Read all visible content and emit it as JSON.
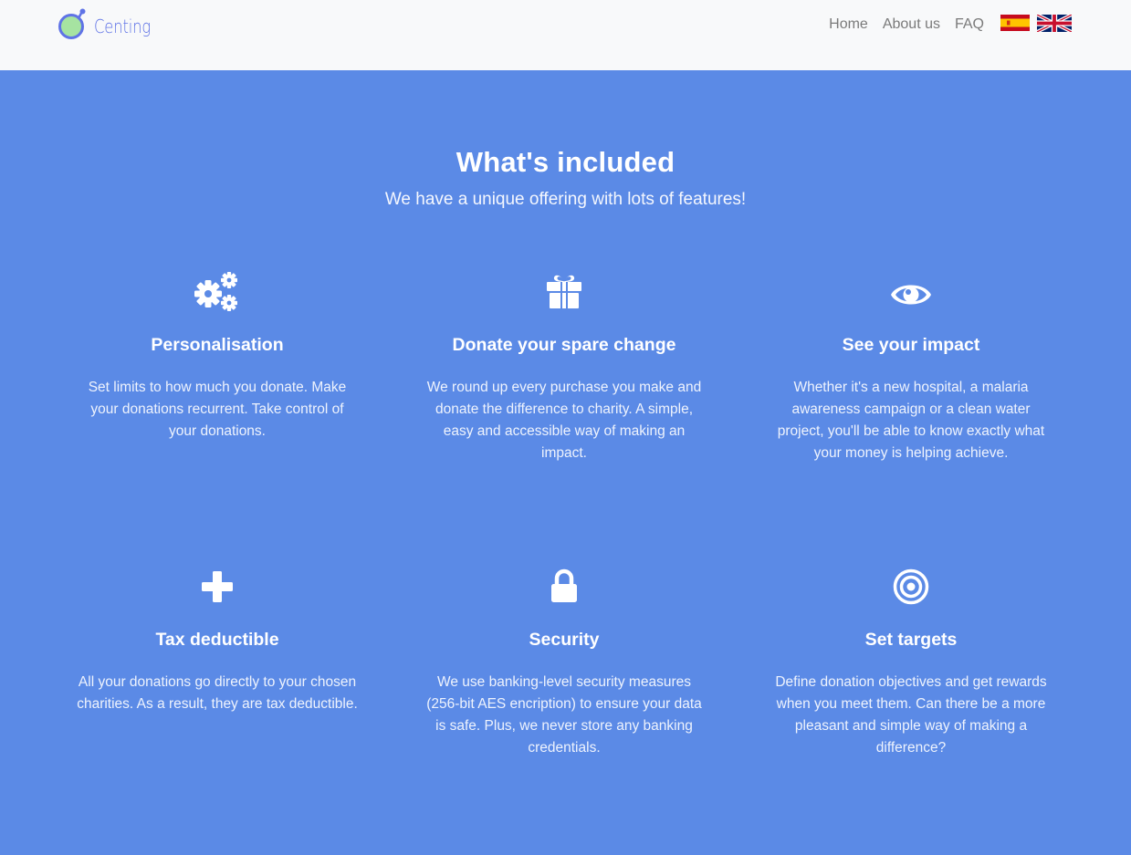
{
  "brand": {
    "name": "Centing",
    "logo_icon": "centing-logo-icon",
    "colors": {
      "ring": "#5f73e6",
      "fill": "#a6e3a1"
    }
  },
  "nav": {
    "links": [
      {
        "label": "Home"
      },
      {
        "label": "About us"
      },
      {
        "label": "FAQ"
      }
    ],
    "languages": [
      {
        "icon": "spain-flag-icon"
      },
      {
        "icon": "uk-flag-icon"
      }
    ]
  },
  "features_section": {
    "title": "What's included",
    "subtitle": "We have a unique offering with lots of features!",
    "background": "#5b8ae6",
    "items": [
      {
        "icon": "cogs-icon",
        "title": "Personalisation",
        "text": "Set limits to how much you donate. Make your donations recurrent. Take control of your donations."
      },
      {
        "icon": "gift-icon",
        "title": "Donate your spare change",
        "text": "We round up every purchase you make and donate the difference to charity. A simple, easy and accessible way of making an impact."
      },
      {
        "icon": "eye-icon",
        "title": "See your impact",
        "text": "Whether it's a new hospital, a malaria awareness campaign or a clean water project, you'll be able to know exactly what your money is helping achieve."
      },
      {
        "icon": "plus-icon",
        "title": "Tax deductible",
        "text": "All your donations go directly to your chosen charities. As a result, they are tax deductible."
      },
      {
        "icon": "lock-icon",
        "title": "Security",
        "text": "We use banking-level security measures (256-bit AES encription) to ensure your data is safe. Plus, we never store any banking credentials."
      },
      {
        "icon": "target-icon",
        "title": "Set targets",
        "text": "Define donation objectives and get rewards when you meet them. Can there be a more pleasant and simple way of making a difference?"
      }
    ]
  }
}
